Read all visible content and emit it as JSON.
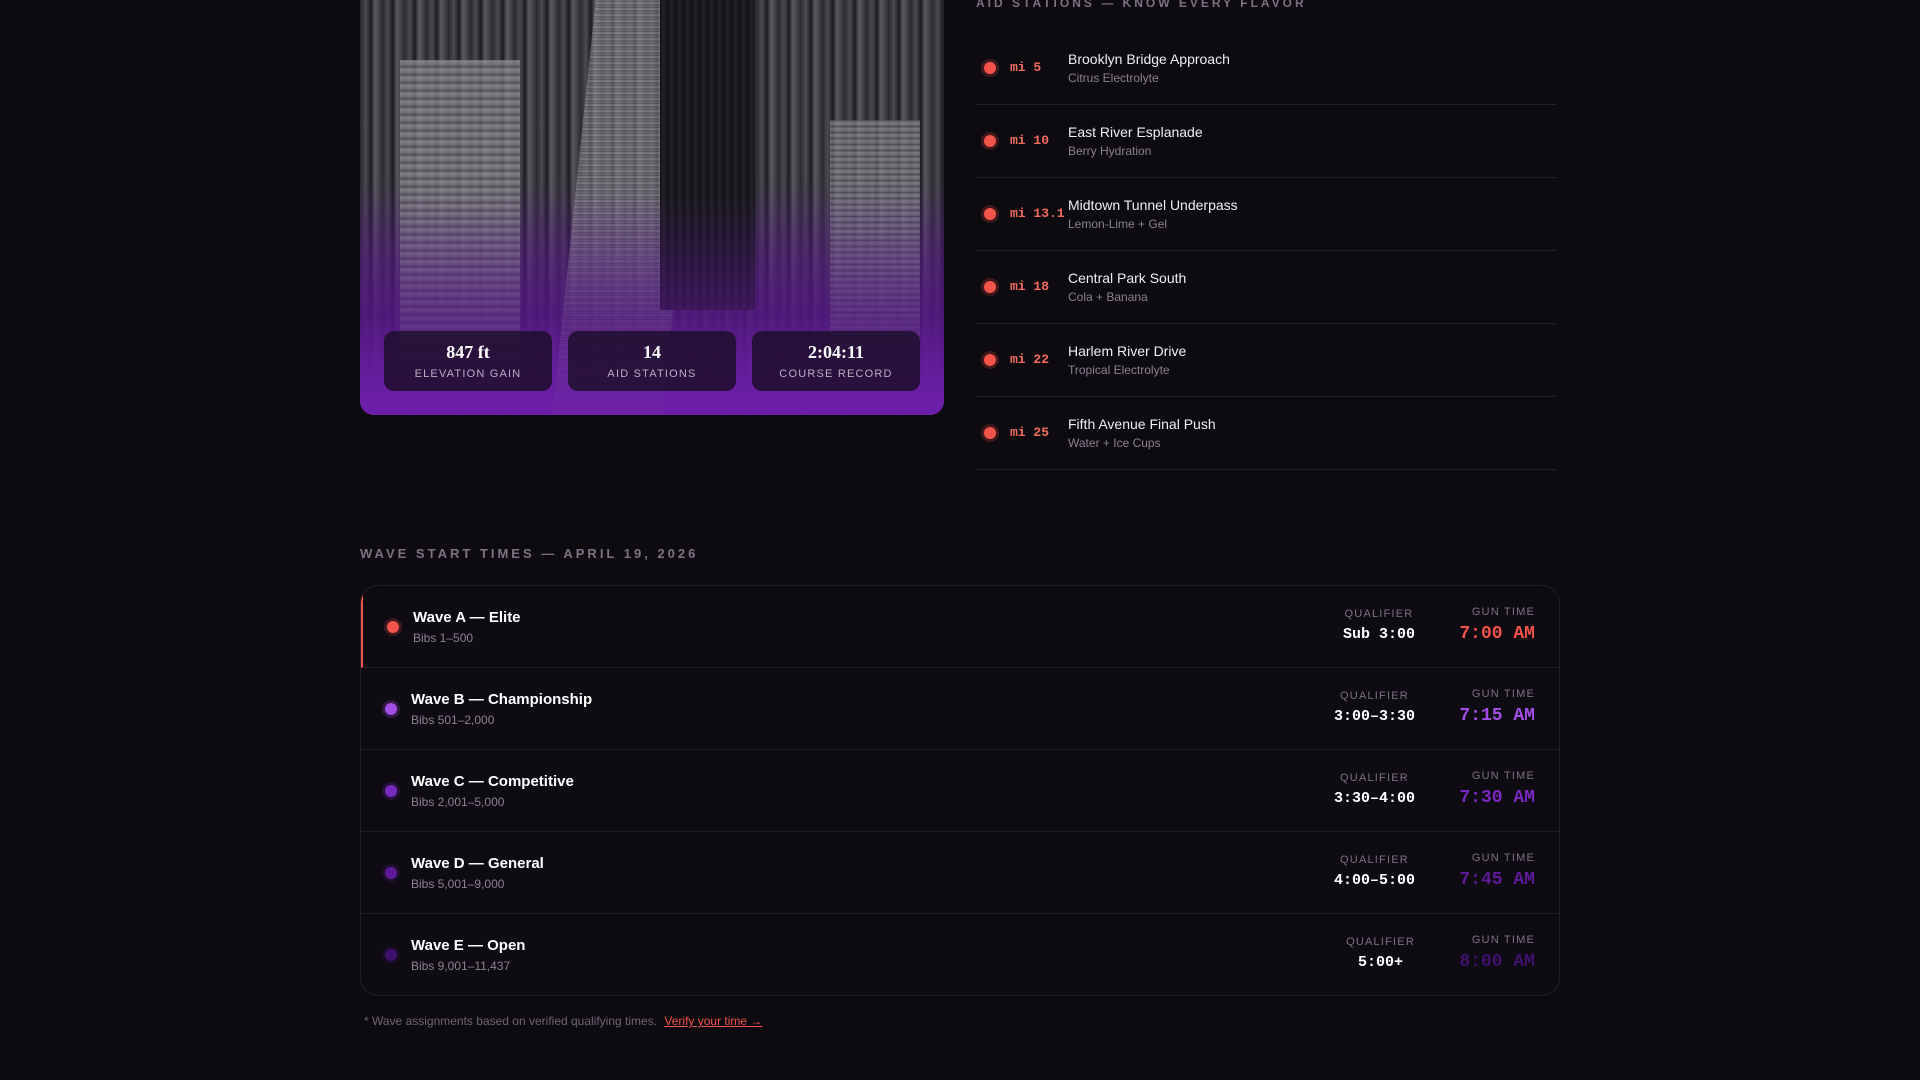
{
  "hero": {
    "image_alt": "Aerial view of marathon runners on city avenue",
    "stats": [
      {
        "value": "847 ft",
        "label": "ELEVATION GAIN"
      },
      {
        "value": "14",
        "label": "AID STATIONS"
      },
      {
        "value": "2:04:11",
        "label": "COURSE RECORD"
      }
    ]
  },
  "aid": {
    "heading": "AID STATIONS — KNOW EVERY FLAVOR",
    "items": [
      {
        "mile": "mi 5",
        "name": "Brooklyn Bridge Approach",
        "flavor": "Citrus Electrolyte"
      },
      {
        "mile": "mi 10",
        "name": "East River Esplanade",
        "flavor": "Berry Hydration"
      },
      {
        "mile": "mi 13.1",
        "name": "Midtown Tunnel Underpass",
        "flavor": "Lemon-Lime + Gel"
      },
      {
        "mile": "mi 18",
        "name": "Central Park South",
        "flavor": "Cola + Banana"
      },
      {
        "mile": "mi 22",
        "name": "Harlem River Drive",
        "flavor": "Tropical Electrolyte"
      },
      {
        "mile": "mi 25",
        "name": "Fifth Avenue Final Push",
        "flavor": "Water + Ice Cups"
      }
    ]
  },
  "waves": {
    "heading": "WAVE START TIMES — APRIL 19, 2026",
    "qualifier_label": "QUALIFIER",
    "gun_label": "GUN TIME",
    "rows": [
      {
        "name": "Wave A — Elite",
        "bibs": "Bibs 1–500",
        "qualifier": "Sub 3:00",
        "gun": "7:00 AM",
        "color": "#f2544a"
      },
      {
        "name": "Wave B — Championship",
        "bibs": "Bibs 501–2,000",
        "qualifier": "3:00–3:30",
        "gun": "7:15 AM",
        "color": "#a24ee6"
      },
      {
        "name": "Wave C — Competitive",
        "bibs": "Bibs 2,001–5,000",
        "qualifier": "3:30–4:00",
        "gun": "7:30 AM",
        "color": "#7a28c2"
      },
      {
        "name": "Wave D — General",
        "bibs": "Bibs 5,001–9,000",
        "qualifier": "4:00–5:00",
        "gun": "7:45 AM",
        "color": "#5c1a98"
      },
      {
        "name": "Wave E — Open",
        "bibs": "Bibs 9,001–11,437",
        "qualifier": "5:00+",
        "gun": "8:00 AM",
        "color": "#40106e"
      }
    ]
  },
  "footnote": {
    "text": "* Wave assignments based on verified qualifying times.",
    "link": "Verify your time →"
  }
}
